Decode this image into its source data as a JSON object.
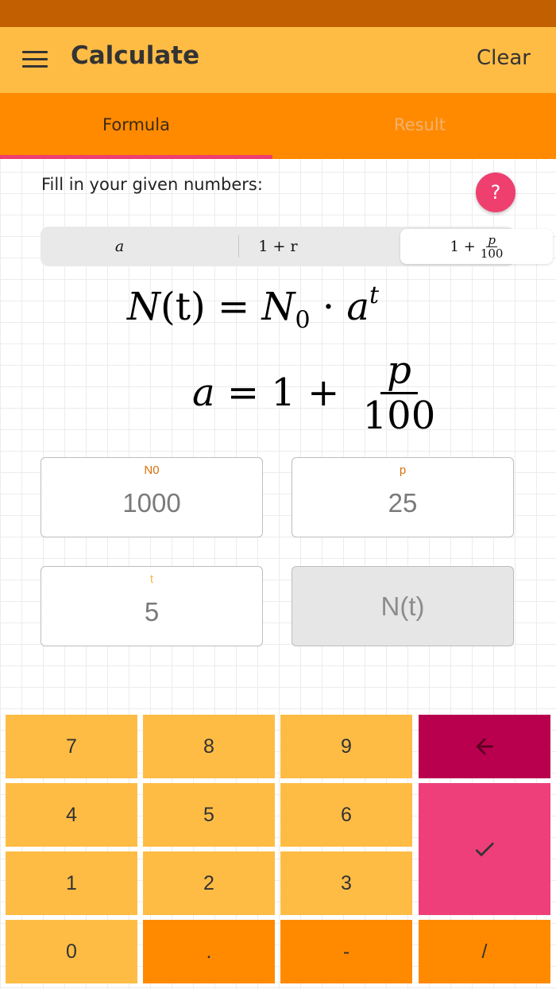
{
  "appbar": {
    "title": "Calculate",
    "clear_label": "Clear",
    "menu_icon": "menu-icon"
  },
  "tabs": {
    "formula": "Formula",
    "result": "Result"
  },
  "instruction": "Fill in your given numbers:",
  "help": {
    "label": "?"
  },
  "segments": {
    "a": "a",
    "one_plus_r": "1 + r",
    "one_plus": "1 +",
    "frac_num": "p",
    "frac_den": "100",
    "selected": "1 + p/100"
  },
  "formula": {
    "line1": {
      "lhs_N": "N",
      "lhs_arg": "(t)",
      "eq": " = ",
      "N0_base": "N",
      "N0_sub": "0",
      "dot": " · ",
      "base": "a",
      "exp": "t"
    },
    "line2": {
      "lhs": "a",
      "eq": " = 1 + ",
      "num": "p",
      "den": "100"
    }
  },
  "fields": {
    "n0": {
      "label": "N0",
      "value": "1000"
    },
    "p": {
      "label": "p",
      "value": "25"
    },
    "t": {
      "label": "t",
      "value": "5"
    },
    "nt": {
      "placeholder": "N(t)"
    }
  },
  "keypad": {
    "k7": "7",
    "k8": "8",
    "k9": "9",
    "k4": "4",
    "k5": "5",
    "k6": "6",
    "k1": "1",
    "k2": "2",
    "k3": "3",
    "k0": "0",
    "kdot": ".",
    "kminus": "-",
    "kslash": "/",
    "backspace_icon": "backspace-arrow-icon",
    "confirm_icon": "checkmark-icon"
  },
  "colors": {
    "status_bar": "#c25f00",
    "app_bar": "#ffbc45",
    "tab_bar": "#ff8a00",
    "accent_pink": "#ee3f6f",
    "backspace_key": "#b8004e",
    "key_yellow": "#ffbc45",
    "key_orange": "#ff8a00"
  }
}
